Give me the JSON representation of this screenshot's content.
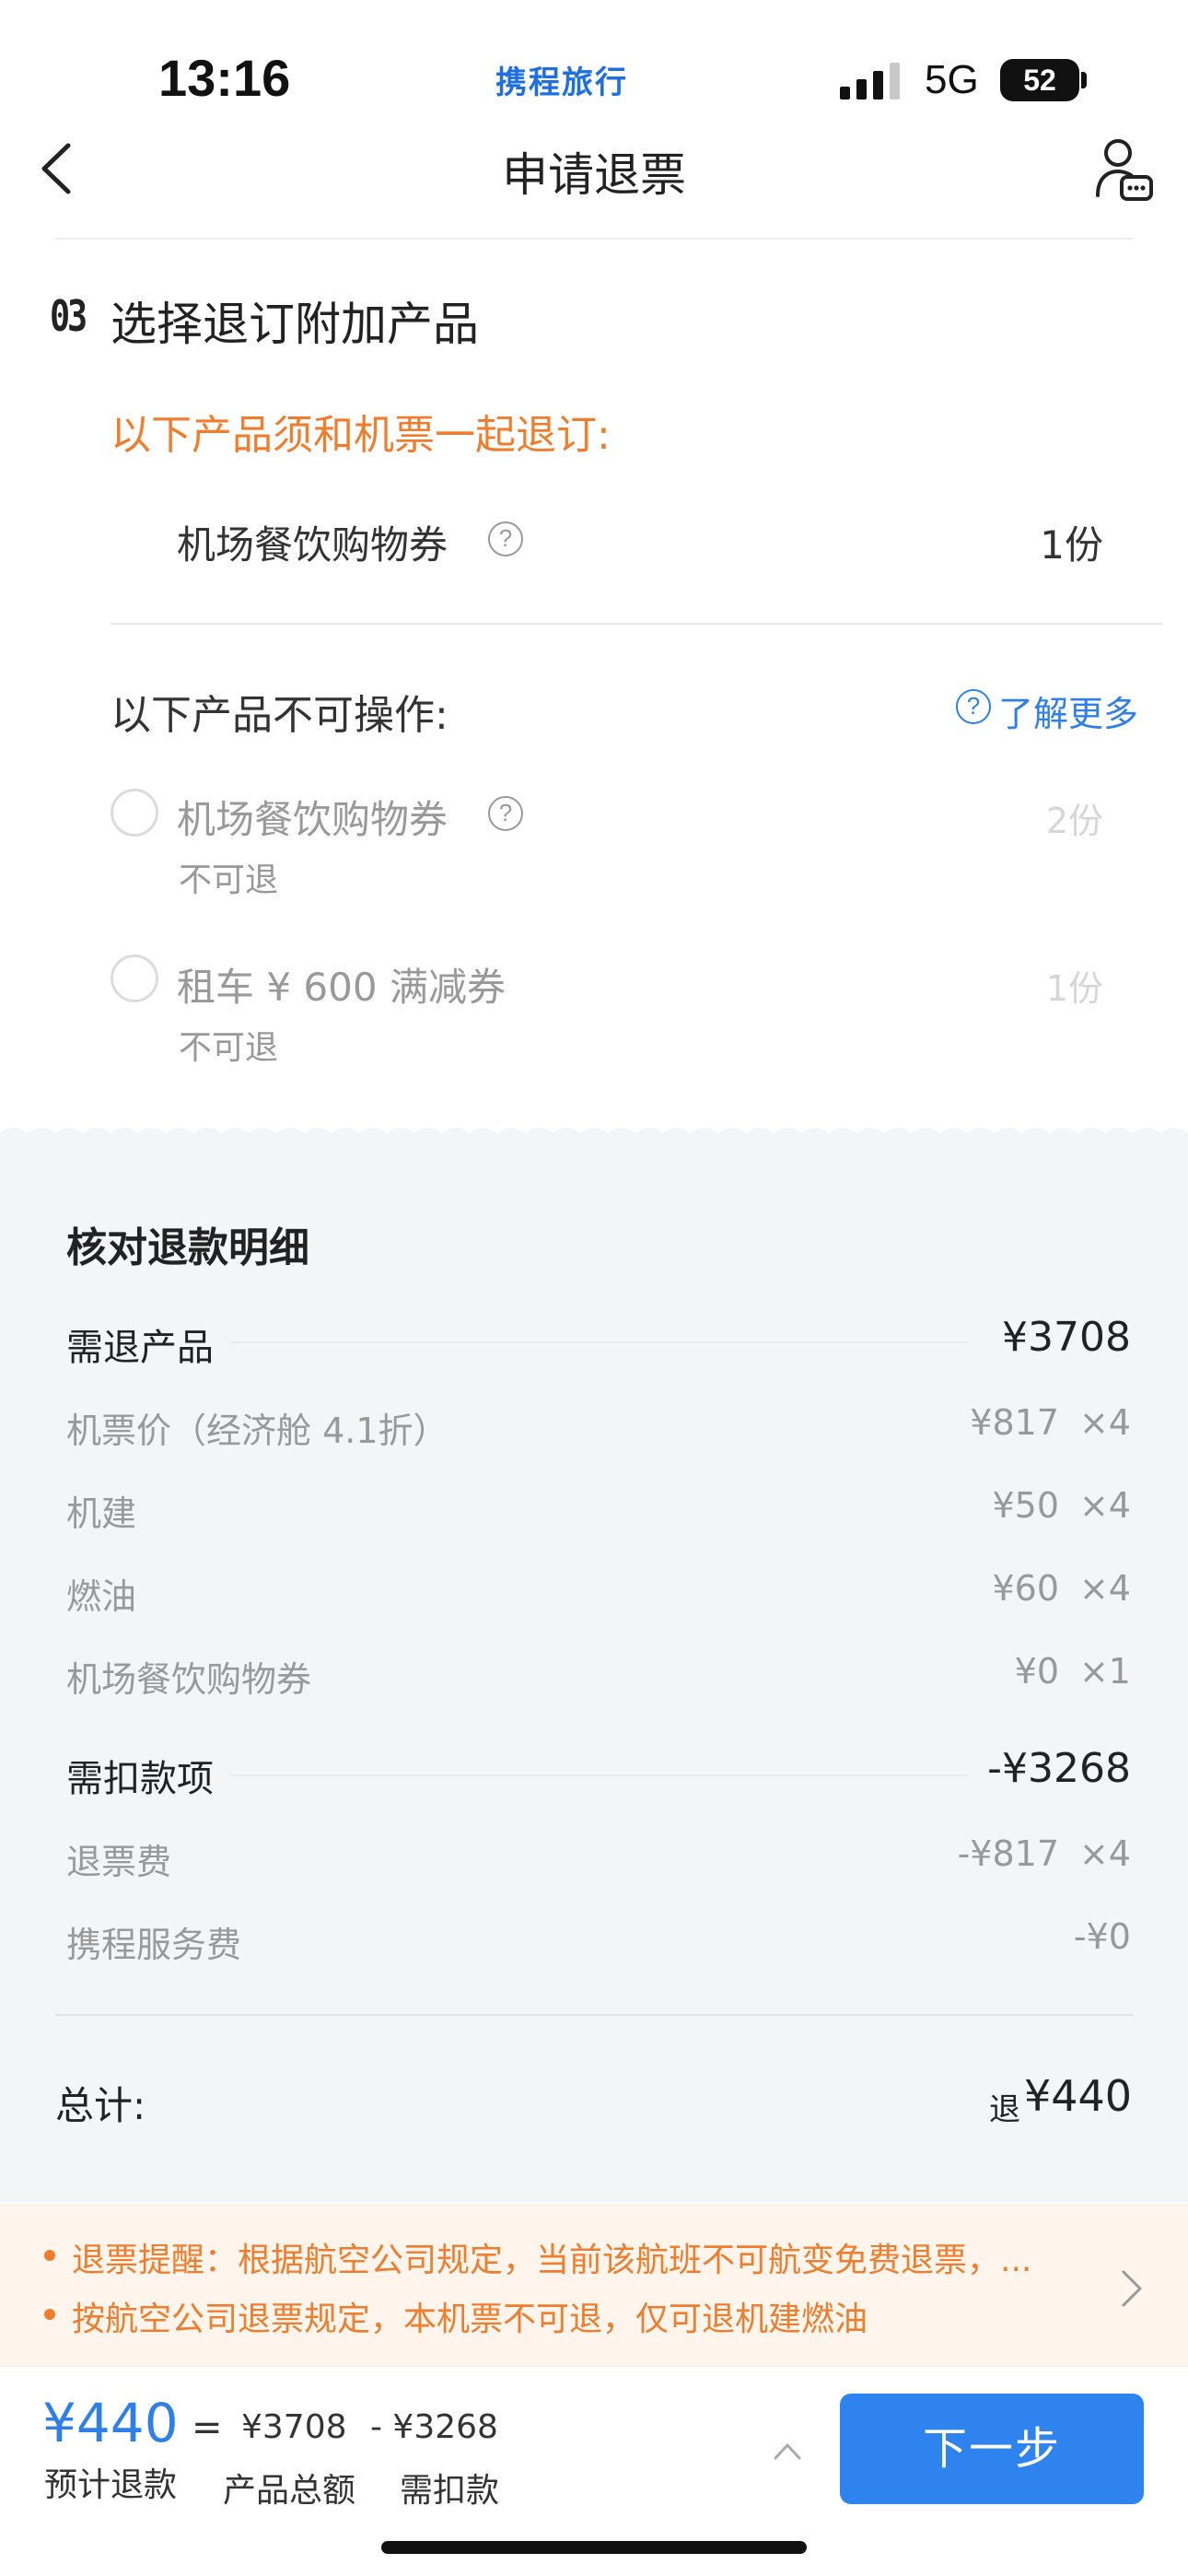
{
  "status_bar": {
    "time": "13:16",
    "brand": "携程旅行",
    "network": "5G",
    "battery": "52"
  },
  "nav": {
    "title": "申请退票"
  },
  "section": {
    "number": "03",
    "title": "选择退订附加产品",
    "must_refund_title": "以下产品须和机票一起退订:",
    "must_items": [
      {
        "label": "机场餐饮购物券",
        "qty": "1份"
      }
    ],
    "noop_title": "以下产品不可操作:",
    "learn_more": "了解更多",
    "disabled_items": [
      {
        "label": "机场餐饮购物券",
        "sub": "不可退",
        "qty": "2份"
      },
      {
        "label": "租车 ¥ 600 满减券",
        "sub": "不可退",
        "qty": "1份"
      }
    ]
  },
  "details": {
    "title": "核对退款明细",
    "refund_products": {
      "label": "需退产品",
      "value": "¥3708"
    },
    "refund_items": [
      {
        "label": "机票价（经济舱 4.1折）",
        "price": "¥817",
        "mult": "×4"
      },
      {
        "label": "机建",
        "price": "¥50",
        "mult": "×4"
      },
      {
        "label": "燃油",
        "price": "¥60",
        "mult": "×4"
      },
      {
        "label": "机场餐饮购物券",
        "price": "¥0",
        "mult": "×1"
      }
    ],
    "deductions": {
      "label": "需扣款项",
      "value": "-¥3268"
    },
    "deduction_items": [
      {
        "label": "退票费",
        "price": "-¥817",
        "mult": "×4"
      },
      {
        "label": "携程服务费",
        "price": "-¥0",
        "mult": ""
      }
    ],
    "total_label": "总计:",
    "total_prefix": "退",
    "total_value": "¥440"
  },
  "notice": {
    "line1": "退票提醒：根据航空公司规定，当前该航班不可航变免费退票，...",
    "line2": "按航空公司退票规定，本机票不可退，仅可退机建燃油"
  },
  "bottom": {
    "estimate_value": "¥440",
    "estimate_label": "预计退款",
    "equals": "=",
    "product_total_value": "¥3708",
    "product_total_label": "产品总额",
    "deduct_value": "- ¥3268",
    "deduct_label": "需扣款",
    "next_button": "下一步"
  },
  "colors": {
    "accent": "#2f83ee",
    "warning": "#ef7d2e",
    "background_gray": "#f4f5f7"
  }
}
